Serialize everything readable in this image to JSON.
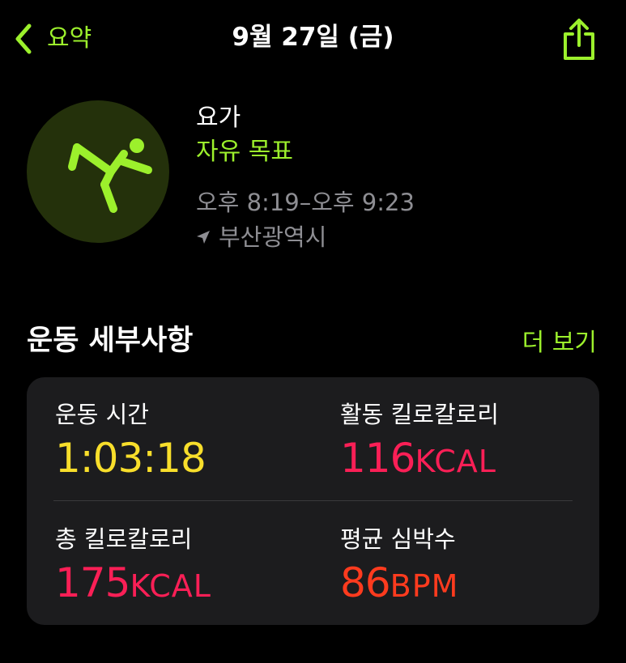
{
  "nav": {
    "back_label": "요약",
    "title": "9월 27일 (금)",
    "back_icon": "chevron-left-icon",
    "share_icon": "share-icon"
  },
  "workout": {
    "icon": "yoga-figure-icon",
    "name": "요가",
    "goal": "자유 목표",
    "time_range": "오후 8:19–오후 9:23",
    "location_icon": "location-arrow-icon",
    "location": "부산광역시"
  },
  "details": {
    "title": "운동 세부사항",
    "show_more": "더 보기",
    "metrics": [
      {
        "label": "운동 시간",
        "value": "1:03:18",
        "unit": "",
        "color": "#f8de2b"
      },
      {
        "label": "활동 킬로칼로리",
        "value": "116",
        "unit": "KCAL",
        "color": "#fa1f56"
      },
      {
        "label": "총 킬로칼로리",
        "value": "175",
        "unit": "KCAL",
        "color": "#fa1f56"
      },
      {
        "label": "평균 심박수",
        "value": "86",
        "unit": "BPM",
        "color": "#ff3b1e"
      }
    ]
  },
  "colors": {
    "accent": "#9cf02c",
    "background": "#000000",
    "card": "#1c1c1e",
    "secondary_text": "#8e8e93",
    "icon_circle": "#24310b"
  }
}
